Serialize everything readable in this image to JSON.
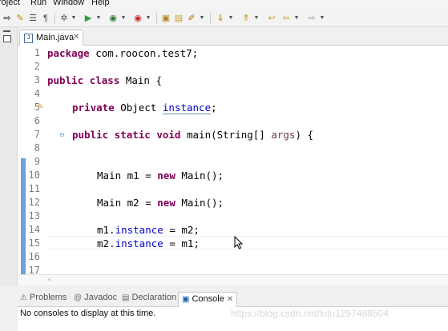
{
  "menu": [
    "roject",
    "Run",
    "Window",
    "Help"
  ],
  "editor_tab": {
    "label": "Main.java",
    "close": "✕"
  },
  "line_numbers": [
    "1",
    "2",
    "3",
    "4",
    "5",
    "6",
    "7",
    "8",
    "9",
    "10",
    "11",
    "12",
    "13",
    "14",
    "15",
    "16",
    "17"
  ],
  "code": {
    "l1_kw": "package",
    "l1_rest": " com.roocon.test7;",
    "l3_kw": "public class",
    "l3_rest": " Main {",
    "l5_kw": "private",
    "l5_type": " Object ",
    "l5_field": "instance",
    "l5_end": ";",
    "l7_kw": "public static void",
    "l7_rest": " main(String[] ",
    "l7_arg": "args",
    "l7_end": ") {",
    "l10_a": "Main m1 = ",
    "l10_kw": "new",
    "l10_b": " Main();",
    "l12_a": "Main m2 = ",
    "l12_kw": "new",
    "l12_b": " Main();",
    "l14_a": "m1.",
    "l14_field": "instance",
    "l14_b": " = m2;",
    "l15_a": "m2.",
    "l15_field": "instance",
    "l15_b": " = m1;"
  },
  "bottom_tabs": [
    "Problems",
    "Javadoc",
    "Declaration",
    "Console"
  ],
  "console_close": "✕",
  "console_message": "No consoles to display at this time.",
  "watermark": "https://blog.csdn.net/lotu1297488504",
  "colors": {
    "keyword": "#7f0055",
    "field": "#0000c0",
    "argument": "#6a3e3e",
    "fold_bar": "#6f9fd8"
  }
}
